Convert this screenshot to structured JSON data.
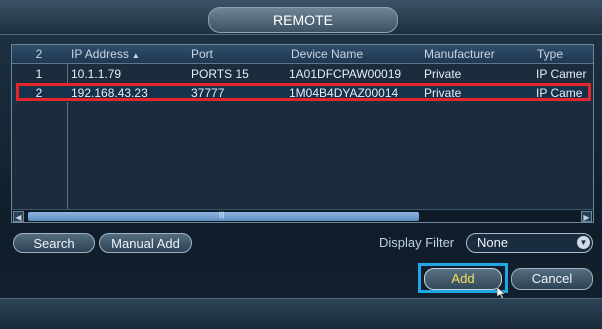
{
  "window": {
    "title": "REMOTE"
  },
  "table": {
    "header": {
      "count": "2",
      "ip_address": "IP Address",
      "port": "Port",
      "device_name": "Device Name",
      "manufacturer": "Manufacturer",
      "type": "Type"
    },
    "rows": [
      {
        "index": "1",
        "ip_address": "10.1.1.79",
        "port": "PORTS 15",
        "device_name": "1A01DFCPAW00019",
        "manufacturer": "Private",
        "type": "IP Camer"
      },
      {
        "index": "2",
        "ip_address": "192.168.43.23",
        "port": "37777",
        "device_name": "1M04B4DYAZ00014",
        "manufacturer": "Private",
        "type": "IP Came"
      }
    ],
    "selected_row": 2
  },
  "scrollbar": {
    "grip": "|||"
  },
  "buttons": {
    "search": "Search",
    "manual_add": "Manual Add",
    "add": "Add",
    "cancel": "Cancel"
  },
  "display_filter": {
    "label": "Display Filter",
    "value": "None"
  },
  "colors": {
    "selection_outline": "#e4252c",
    "add_highlight": "#21a6e6",
    "add_label": "#f4e25c",
    "scroll_thumb": "#7aa6d6"
  },
  "icons": {
    "sort": "sort-ascending-icon",
    "dropdown": "chevron-down-icon",
    "cursor": "mouse-pointer-icon",
    "scroll_left": "arrow-left-icon",
    "scroll_right": "arrow-right-icon"
  }
}
